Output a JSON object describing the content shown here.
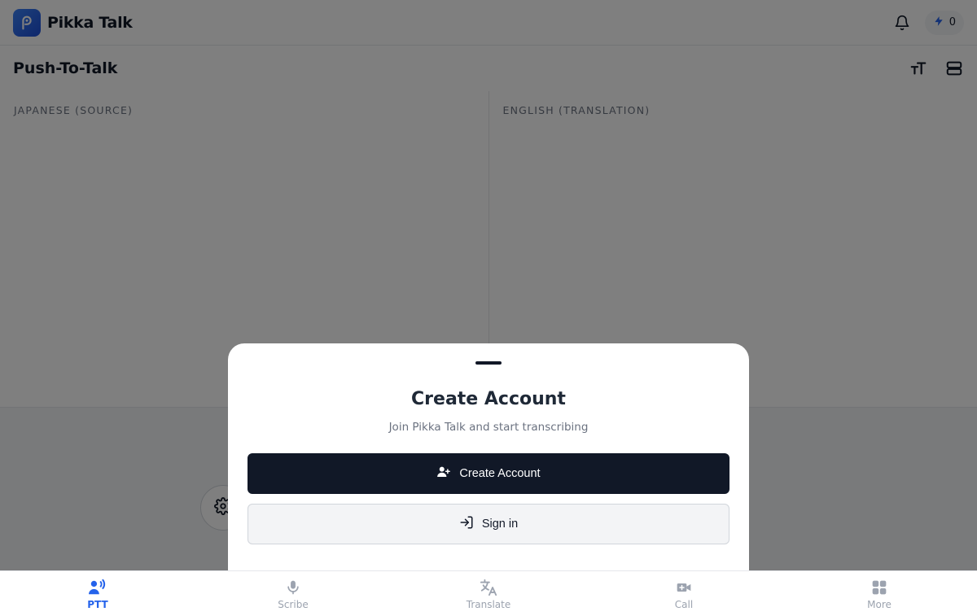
{
  "header": {
    "brand_name": "Pikka Talk",
    "credits": "0"
  },
  "page": {
    "title": "Push-To-Talk"
  },
  "panels": {
    "source_label": "JAPANESE (SOURCE)",
    "translation_label": "ENGLISH (TRANSLATION)"
  },
  "modal": {
    "title": "Create Account",
    "subtitle": "Join Pikka Talk and start transcribing",
    "create_label": "Create Account",
    "signin_label": "Sign in"
  },
  "nav": {
    "items": [
      {
        "label": "PTT",
        "icon": "ptt-icon",
        "active": true
      },
      {
        "label": "Scribe",
        "icon": "microphone-icon",
        "active": false
      },
      {
        "label": "Translate",
        "icon": "translate-icon",
        "active": false
      },
      {
        "label": "Call",
        "icon": "video-call-icon",
        "active": false
      },
      {
        "label": "More",
        "icon": "grid-icon",
        "active": false
      }
    ]
  },
  "colors": {
    "accent": "#2563eb",
    "primary_button": "#111827",
    "credits_bolt": "#2563eb"
  }
}
